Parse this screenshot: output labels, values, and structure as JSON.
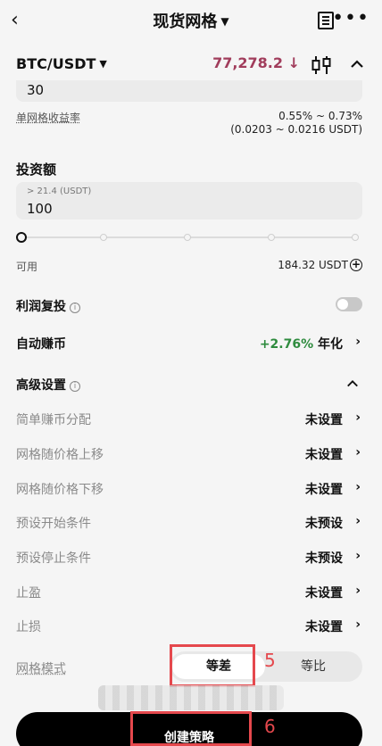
{
  "header": {
    "title": "现货网格",
    "back_icon": "back-icon",
    "doc_icon": "document-icon",
    "more_icon": "more-icon"
  },
  "pair": {
    "name": "BTC/USDT",
    "price": "77,278.2 ↓",
    "price_color": "#a13d5c"
  },
  "grid_count": {
    "value": "30"
  },
  "profit_per_grid": {
    "label": "单网格收益率",
    "percent_range": "0.55% ~ 0.73%",
    "usdt_range": "(0.0203 ~ 0.0216 USDT)"
  },
  "investment": {
    "label": "投资额",
    "placeholder": "> 21.4 (USDT)",
    "value": "100",
    "slider_percent": 0
  },
  "available": {
    "label": "可用",
    "value": "184.32 USDT"
  },
  "profit_compound": {
    "label": "利润复投",
    "enabled": false
  },
  "auto_earn": {
    "label": "自动赚币",
    "rate": "+2.76%",
    "suffix": "年化"
  },
  "advanced": {
    "label": "高级设置",
    "items": [
      {
        "label": "简单赚币分配",
        "value": "未设置"
      },
      {
        "label": "网格随价格上移",
        "value": "未设置"
      },
      {
        "label": "网格随价格下移",
        "value": "未设置"
      },
      {
        "label": "预设开始条件",
        "value": "未预设"
      },
      {
        "label": "预设停止条件",
        "value": "未预设"
      },
      {
        "label": "止盈",
        "value": "未设置"
      },
      {
        "label": "止损",
        "value": "未设置"
      }
    ]
  },
  "grid_mode": {
    "label": "网格模式",
    "options": [
      "等差",
      "等比"
    ],
    "selected": "等差"
  },
  "annotations": {
    "five": "5",
    "six": "6"
  },
  "create_button": {
    "label": "创建策略"
  }
}
